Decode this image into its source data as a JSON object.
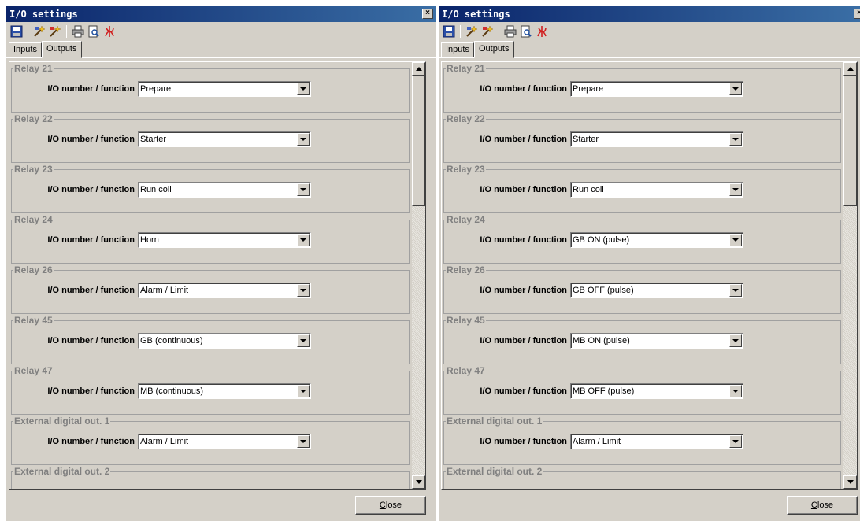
{
  "windows": [
    {
      "title": "I/O settings",
      "close_glyph": "×",
      "tabs": [
        {
          "label": "Inputs",
          "active": false
        },
        {
          "label": "Outputs",
          "active": true
        }
      ],
      "row_label": "I/O number / function",
      "groups": [
        {
          "legend": "Relay 21",
          "value": "Prepare"
        },
        {
          "legend": "Relay 22",
          "value": "Starter"
        },
        {
          "legend": "Relay 23",
          "value": "Run coil"
        },
        {
          "legend": "Relay 24",
          "value": "Horn"
        },
        {
          "legend": "Relay 26",
          "value": "Alarm / Limit"
        },
        {
          "legend": "Relay 45",
          "value": "GB (continuous)"
        },
        {
          "legend": "Relay 47",
          "value": "MB (continuous)"
        },
        {
          "legend": "External digital out. 1",
          "value": "Alarm / Limit"
        },
        {
          "legend": "External digital out. 2",
          "value": ""
        }
      ],
      "close_button": {
        "underlined": "C",
        "rest": "lose"
      }
    },
    {
      "title": "I/O settings",
      "close_glyph": "×",
      "tabs": [
        {
          "label": "Inputs",
          "active": false
        },
        {
          "label": "Outputs",
          "active": true
        }
      ],
      "row_label": "I/O number / function",
      "groups": [
        {
          "legend": "Relay 21",
          "value": "Prepare"
        },
        {
          "legend": "Relay 22",
          "value": "Starter"
        },
        {
          "legend": "Relay 23",
          "value": "Run coil"
        },
        {
          "legend": "Relay 24",
          "value": "GB ON (pulse)"
        },
        {
          "legend": "Relay 26",
          "value": "GB OFF (pulse)"
        },
        {
          "legend": "Relay 45",
          "value": "MB ON (pulse)"
        },
        {
          "legend": "Relay 47",
          "value": "MB OFF (pulse)"
        },
        {
          "legend": "External digital out. 1",
          "value": "Alarm / Limit"
        },
        {
          "legend": "External digital out. 2",
          "value": ""
        }
      ],
      "close_button": {
        "underlined": "C",
        "rest": "lose"
      }
    }
  ],
  "toolbar_icons": [
    "save-icon",
    "wizard-icon",
    "wizard-alt-icon",
    "print-icon",
    "print-preview-icon",
    "pdf-icon"
  ],
  "colors": {
    "titlebar": "#0a246a",
    "face": "#d4d0c8",
    "legend_text": "#808080"
  }
}
